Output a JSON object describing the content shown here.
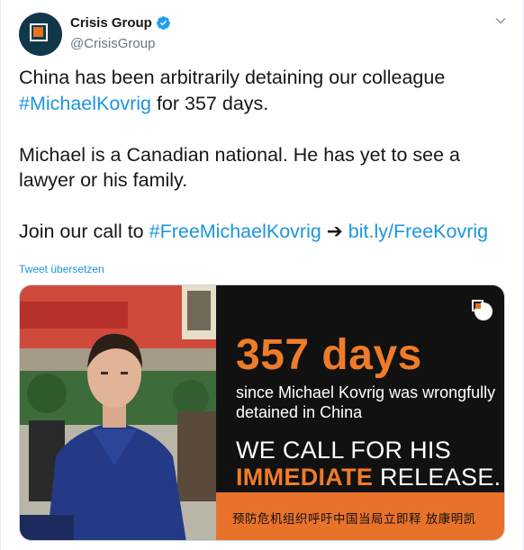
{
  "author": {
    "name": "Crisis Group",
    "handle": "@CrisisGroup"
  },
  "icons": {
    "verified": "verified-badge-icon",
    "more": "chevron-down-icon"
  },
  "tweet": {
    "line1_a": "China has been arbitrarily detaining our colleague",
    "hashtag1": "#MichaelKovrig",
    "line2_b": " for 357 days.",
    "para2": "Michael is a Canadian national. He has yet to see a lawyer or his family.",
    "para3_a": "Join our call to ",
    "hashtag2": "#FreeMichaelKovrig",
    "arrow": " ➔ ",
    "url": "bit.ly/FreeKovrig"
  },
  "translate_label": "Tweet übersetzen",
  "media": {
    "headline": "357 days",
    "subline": "since Michael Kovrig was wrongfully detained in China",
    "call_line1": "WE CALL FOR HIS",
    "call_emphasis": "IMMEDIATE",
    "call_line2_rest": " RELEASE.",
    "chinese_line": "预防危机组织呼吁中国当局立即释 放康明凯"
  },
  "colors": {
    "link": "#1b95e0",
    "accent_orange": "#ef7b2a",
    "panel_black": "#111111"
  }
}
